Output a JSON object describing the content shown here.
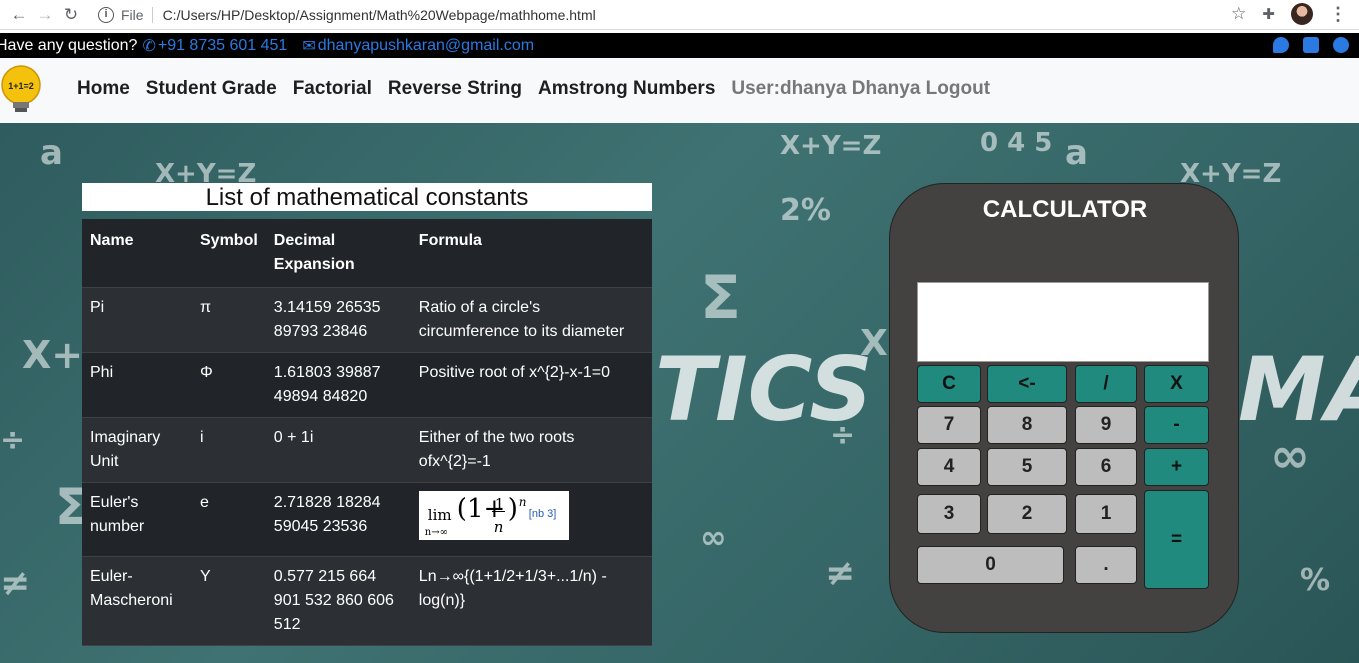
{
  "browser": {
    "file_label": "File",
    "url": "C:/Users/HP/Desktop/Assignment/Math%20Webpage/mathhome.html"
  },
  "topbar": {
    "question": "Have any question?",
    "phone": "+91 8735 601 451",
    "email": "dhanyapushkaran@gmail.com",
    "accent_color": "#2a7ae2"
  },
  "logo_text": "1+1=2",
  "nav": {
    "items": [
      "Home",
      "Student Grade",
      "Factorial",
      "Reverse String",
      "Amstrong Numbers"
    ],
    "user": "User:dhanya Dhanya Logout"
  },
  "background_text": {
    "words": [
      "TICS",
      "MA"
    ]
  },
  "constants": {
    "title": "List of mathematical constants",
    "headers": [
      "Name",
      "Symbol",
      "Decimal Expansion",
      "Formula"
    ],
    "rows": [
      {
        "name": "Pi",
        "symbol": "π",
        "decimal": "3.14159 26535 89793 23846",
        "formula": "Ratio of a circle's circumference to its diameter"
      },
      {
        "name": "Phi",
        "symbol": "Φ",
        "decimal": "1.61803 39887 49894 84820",
        "formula": "Positive root of x^{2}-x-1=0"
      },
      {
        "name": "Imaginary Unit",
        "symbol": "i",
        "decimal": "0 + 1i",
        "formula": "Either of the two roots ofx^{2}=-1"
      },
      {
        "name": "Euler's number",
        "symbol": "e",
        "decimal": "2.71828 18284 59045 23536",
        "formula": ""
      },
      {
        "name": "Euler-Mascheroni",
        "symbol": "Y",
        "decimal": "0.577 215 664 901 532 860 606 512",
        "formula": "Ln→∞{(1+1/2+1/3+...1/n) - log(n)}"
      }
    ],
    "euler_formula": {
      "lim": "lim",
      "sub": "n→∞",
      "body": "(1+",
      "num": "1",
      "den": "n",
      "close": ")",
      "exp": "n",
      "ref": "[nb 3]"
    }
  },
  "calculator": {
    "title": "CALCULATOR",
    "display_value": "",
    "keys": {
      "clear": "C",
      "back": "<-",
      "divide": "/",
      "multiply": "X",
      "seven": "7",
      "eight": "8",
      "nine": "9",
      "minus": "-",
      "four": "4",
      "five": "5",
      "six": "6",
      "plus": "+",
      "three": "3",
      "two": "2",
      "one": "1",
      "equals": "=",
      "zero": "0",
      "dot": "."
    }
  }
}
